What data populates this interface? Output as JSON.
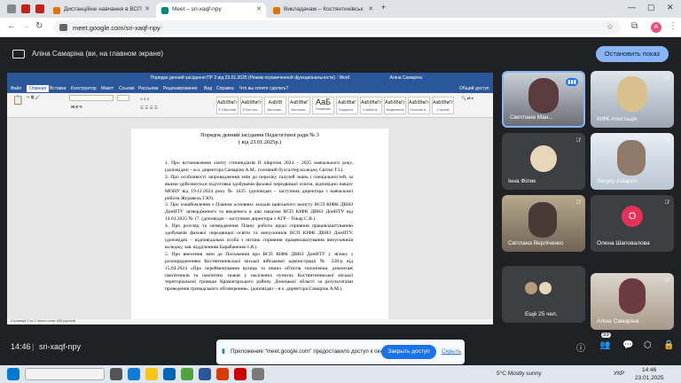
{
  "browser": {
    "tabs": [
      {
        "label": "Дистанційне навчання в ВСП",
        "active": false
      },
      {
        "label": "Meet – sri-xaqf-npy",
        "active": true
      },
      {
        "label": "Викладачам – Костянтинівськ",
        "active": false
      }
    ],
    "url": "meet.google.com/sri-xaqf-npy",
    "profile_initial": "A"
  },
  "meet": {
    "presenter_banner": "Аліна Самаріна (ви, на главном экране)",
    "stop_button": "Остановить показ",
    "time": "14:46",
    "meeting_code": "sri-xaqf-npy",
    "participant_count": "33",
    "participants": [
      {
        "name": "Светлана Ман...",
        "speaking": true
      },
      {
        "name": "КІФК Атестація"
      },
      {
        "name": "Інна Філик"
      },
      {
        "name": "Sergey Astapov"
      },
      {
        "name": "Світлана Верліченко"
      },
      {
        "name": "Олена Шаповалова",
        "initial": "О"
      },
      {
        "name": "Ещё 25 чел."
      },
      {
        "name": "Аліна Самаріна"
      }
    ],
    "notification": {
      "text": "Приложение \"meet.google.com\" предоставило доступ к окну.",
      "action": "Закрыть доступ",
      "hide": "Скрыть"
    }
  },
  "word": {
    "title": "Порядок денний засідання ПР 3 від 23.01.2025 (Режим ограниченной функциональности) - Word",
    "user": "Аліна Самаріна",
    "ribbon_tabs": [
      "Файл",
      "Главная",
      "Вставка",
      "Конструктор",
      "Макет",
      "Ссылки",
      "Рассылки",
      "Рецензирование",
      "Вид",
      "Справка",
      "Что вы хотите сделать?"
    ],
    "share": "Общий доступ",
    "styles": [
      {
        "sample": "АаБбВвГг",
        "name": "¶ Обычный"
      },
      {
        "sample": "АаБбВвГг",
        "name": "¶ Без инт..."
      },
      {
        "sample": "АаБбВ",
        "name": "Заголово..."
      },
      {
        "sample": "АаБбВвГ",
        "name": "Заголово..."
      },
      {
        "sample": "АаБ",
        "name": "Название"
      },
      {
        "sample": "АаБбВвГ",
        "name": "Подзагол..."
      },
      {
        "sample": "АаБбВвГг",
        "name": "Слабое в..."
      },
      {
        "sample": "АаБбВвГг",
        "name": "Выделение"
      },
      {
        "sample": "АаБбВвГг",
        "name": "Сильное в..."
      },
      {
        "sample": "АаБбВвГг",
        "name": "Строгий"
      }
    ],
    "status": "Страница 1 из 1   Число слов: 408   русский",
    "doc_title": "Порядок денний засідання Педагогічної ради № 3",
    "doc_date": "( від 23.01.2025р.)",
    "items": [
      "1. Про встановлення ліміту стипендіатів ІІ півріччя 2024 – 2025 навчального року. (доповідачі – в.о. директора Самаріна А.М., головний бухгалтер коледжу Світко Т.І.).",
      "2. Про особливості запровадження змін до переліку галузей знань і спеціальностей, за якими здійснюється підготовка здобувачів фахової передвищої освіти, відповідно наказу МОНУ від 19.12.2024 року № 1625. (доповідач – заступник директора з навчальної роботи Журавель Г.Ю).",
      "3. Про ознайомлення з Планом основних заходів цивільного захисту ВСП КІФК ДВНЗ ДонНТУ затвердженого та введеного в дію наказом ВСП КІФК ДВНЗ ДонНТУ від 14.01.2025 № 17. (доповідач – заступник директора з АГР – Токар С.В.).",
      "4. Про розгляд та затвердження Плану роботи щодо сприяння працевлаштуванню здобувачів фахової передвищої освіти та випускників ВСП КІФК ДВНЗ ДонНТУ. (доповідач – відповідальна особа з питань сприяння працевлаштування випускників коледжу, зав. відділенням Барабаненко І.Я.).",
      "5. Про внесення змін до Положення про ВСП КІФК ДВНЗ ДонНТУ у зв'язку з розпорядженням Костянтинівської міської військової адміністрації № 228-р від 15.04.2024 «Про перейменування вулиць та інших об'єктів топоніміки, демонтаж пам'ятників та пам'ятних знаків у населених пунктах Костянтинівської міської територіальної громади Краматорського району Донецької області за результатами проведення громадського обговорення». (доповідач – в.о. директора Самаріна А.М.)."
    ]
  },
  "taskbar": {
    "weather": "5°C  Mostly sunny",
    "lang": "УКР",
    "time": "14:46",
    "date": "23.01.2025"
  }
}
